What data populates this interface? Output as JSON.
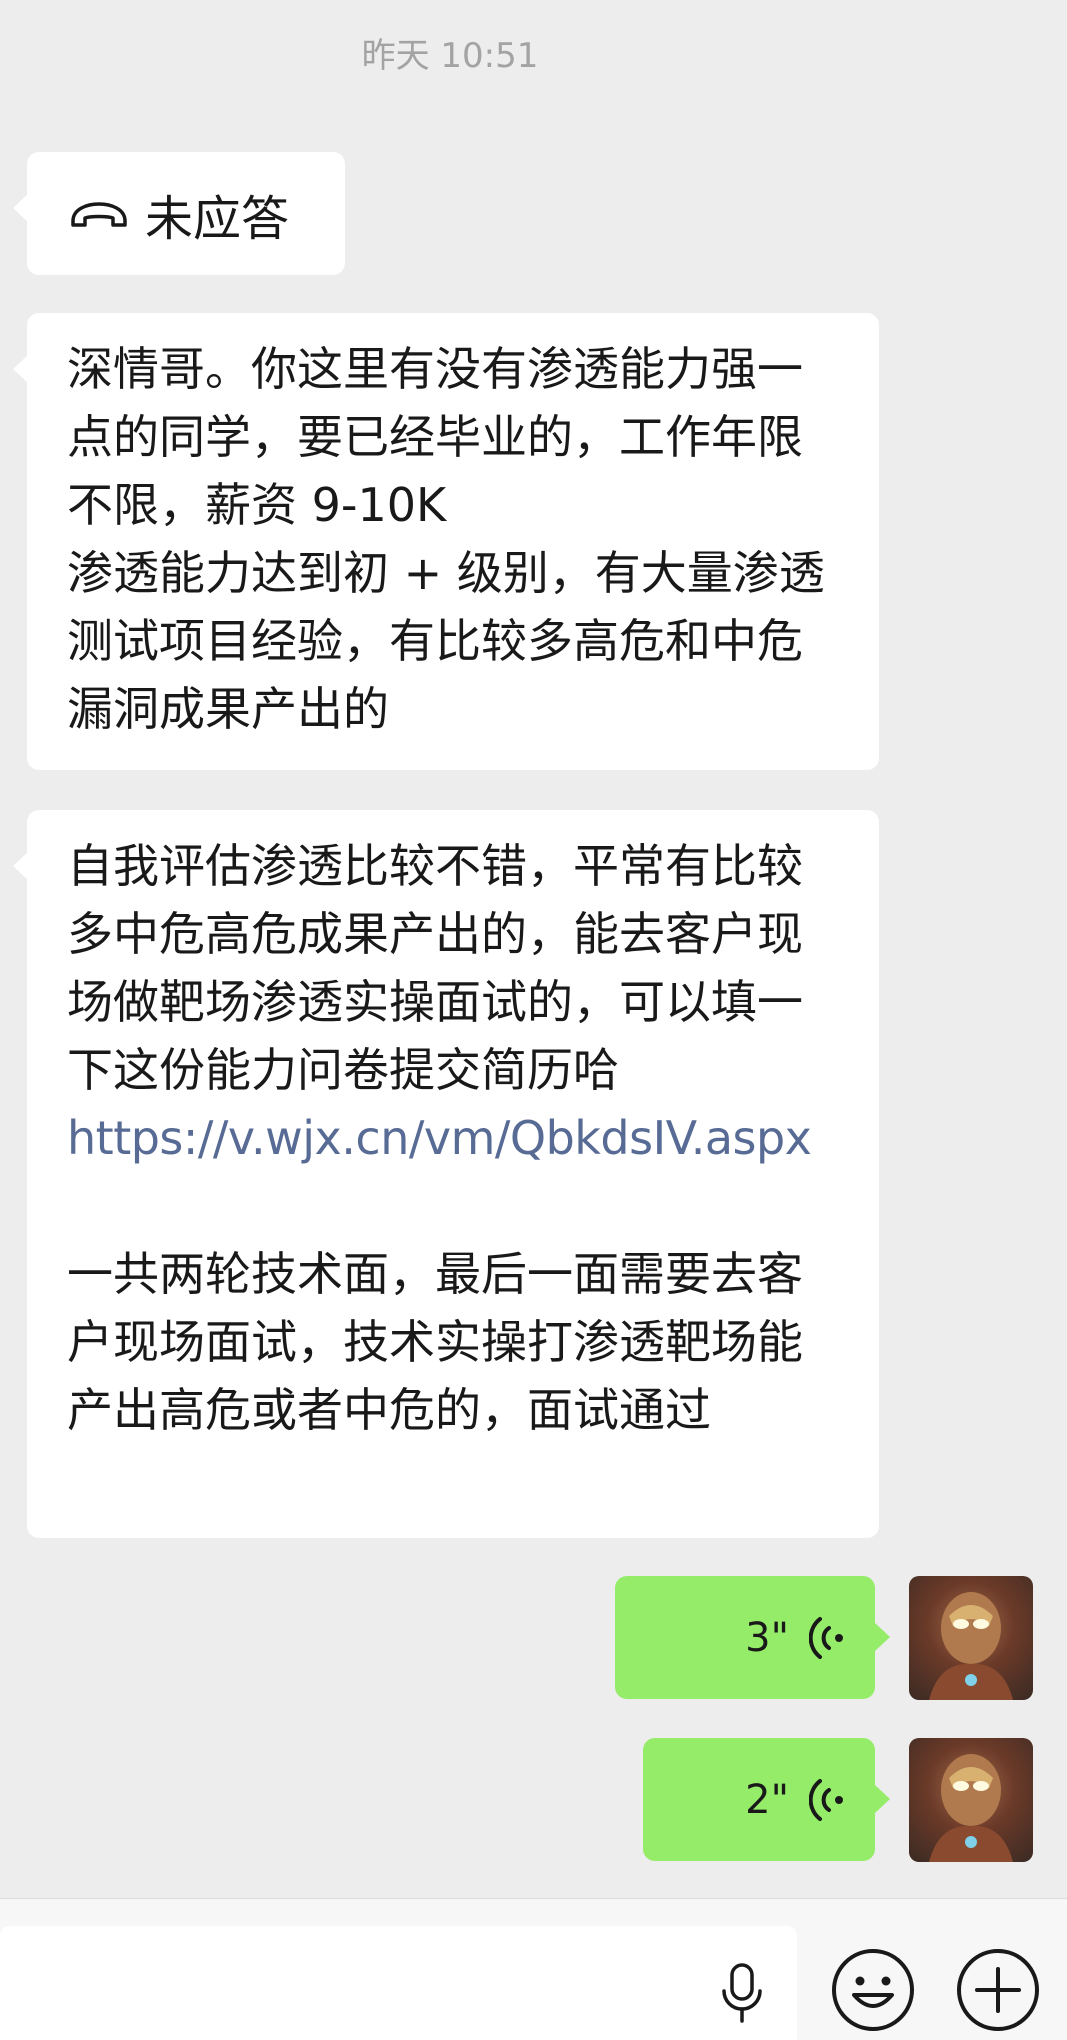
{
  "chat": {
    "timestamp": "昨天 10:51",
    "missed_call_label": "未应答",
    "message1": "深情哥。你这里有没有渗透能力强一点的同学，要已经毕业的，工作年限不限，薪资 9-10K\n渗透能力达到初 + 级别，有大量渗透测试项目经验，有比较多高危和中危漏洞成果产出的",
    "message2_text": "自我评估渗透比较不错，平常有比较多中危高危成果产出的，能去客户现场做靶场渗透实操面试的，可以填一下这份能力问卷提交简历哈",
    "message2_link": "https://v.wjx.cn/vm/QbkdsIV.aspx",
    "message2_footer": "一共两轮技术面，最后一面需要去客户现场面试，技术实操打渗透靶场能产出高危或者中危的，面试通过",
    "voice_messages": [
      {
        "duration": "3\""
      },
      {
        "duration": "2\""
      }
    ]
  },
  "colors": {
    "background": "#ededed",
    "incoming_bubble": "#ffffff",
    "outgoing_bubble": "#95ec69",
    "link": "#576b95",
    "timestamp": "#a3a3a3"
  },
  "icons": {
    "missed_call": "phone-hangup-icon",
    "voice": "voice-wave-icon",
    "mic": "microphone-icon",
    "emoji": "emoji-smile-icon",
    "more": "plus-circle-icon"
  }
}
